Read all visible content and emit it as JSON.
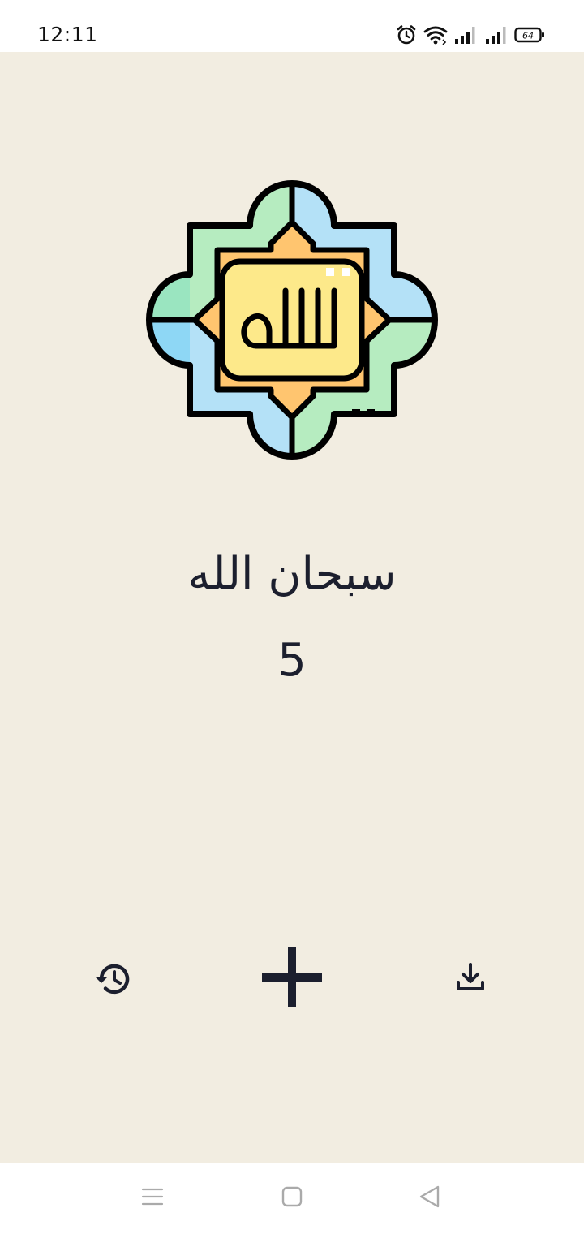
{
  "status_bar": {
    "time": "12:11",
    "battery_level": "64",
    "icons": [
      "alarm-icon",
      "wifi-icon",
      "signal-icon",
      "signal-icon",
      "battery-icon"
    ]
  },
  "main": {
    "emblem": {
      "icon": "allah-calligraphy-emblem",
      "calligraphy": "الله"
    },
    "dhikr": "سبحان الله",
    "count": "5",
    "controls": {
      "reset_icon": "history-icon",
      "increment_icon": "plus-icon",
      "save_icon": "download-icon"
    }
  },
  "nav_bar": {
    "icons": [
      "menu-icon",
      "home-square-icon",
      "back-triangle-icon"
    ]
  },
  "colors": {
    "background": "#f2ede1",
    "text": "#1c1f2e",
    "emblem_yellow": "#fde98a",
    "emblem_orange": "#ffc56f",
    "emblem_green": "#b6ecc0",
    "emblem_blue": "#b4e1f7",
    "emblem_outline": "#000000"
  }
}
